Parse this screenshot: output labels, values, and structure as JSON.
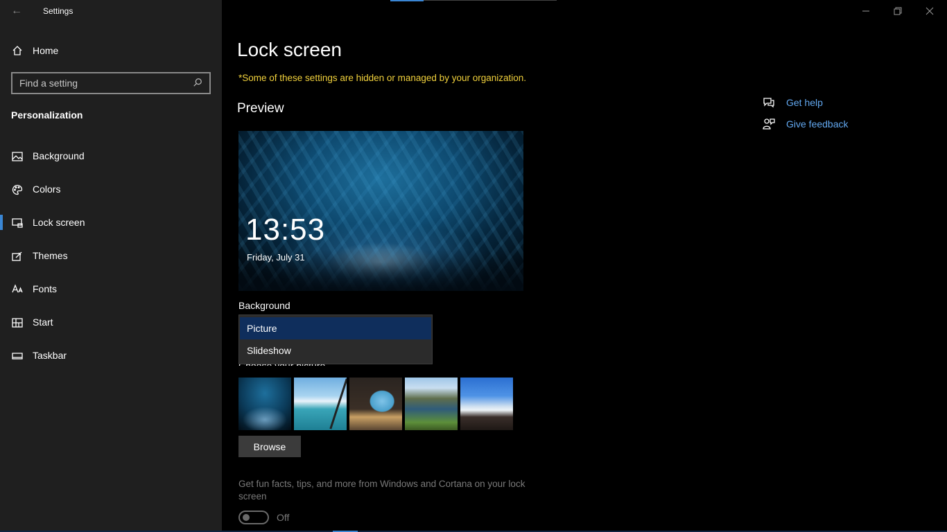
{
  "window": {
    "title": "Settings",
    "back_icon": "back-arrow-icon",
    "controls": [
      "minimize-icon",
      "restore-icon",
      "close-icon"
    ]
  },
  "sidebar": {
    "home_label": "Home",
    "search_placeholder": "Find a setting",
    "section_title": "Personalization",
    "items": [
      {
        "label": "Background",
        "icon": "picture-icon",
        "selected": false
      },
      {
        "label": "Colors",
        "icon": "palette-icon",
        "selected": false
      },
      {
        "label": "Lock screen",
        "icon": "lock-screen-icon",
        "selected": true
      },
      {
        "label": "Themes",
        "icon": "themes-icon",
        "selected": false
      },
      {
        "label": "Fonts",
        "icon": "fonts-icon",
        "selected": false
      },
      {
        "label": "Start",
        "icon": "start-icon",
        "selected": false
      },
      {
        "label": "Taskbar",
        "icon": "taskbar-icon",
        "selected": false
      }
    ],
    "accent_color": "#3a86d4"
  },
  "main": {
    "page_title": "Lock screen",
    "org_notice": "*Some of these settings are hidden or managed by your organization.",
    "preview_heading": "Preview",
    "preview": {
      "time": "13:53",
      "date": "Friday, July 31"
    },
    "background_label": "Background",
    "background_options": [
      "Picture",
      "Slideshow"
    ],
    "background_selected": "Picture",
    "choose_picture_label": "Choose your picture",
    "browse_label": "Browse",
    "tips_text": "Get fun facts, tips, and more from Windows and Cortana on your lock screen",
    "tips_toggle_state": "Off",
    "notice_color": "#f2d23c"
  },
  "help": {
    "get_help": "Get help",
    "give_feedback": "Give feedback",
    "link_color": "#62a8f0"
  }
}
